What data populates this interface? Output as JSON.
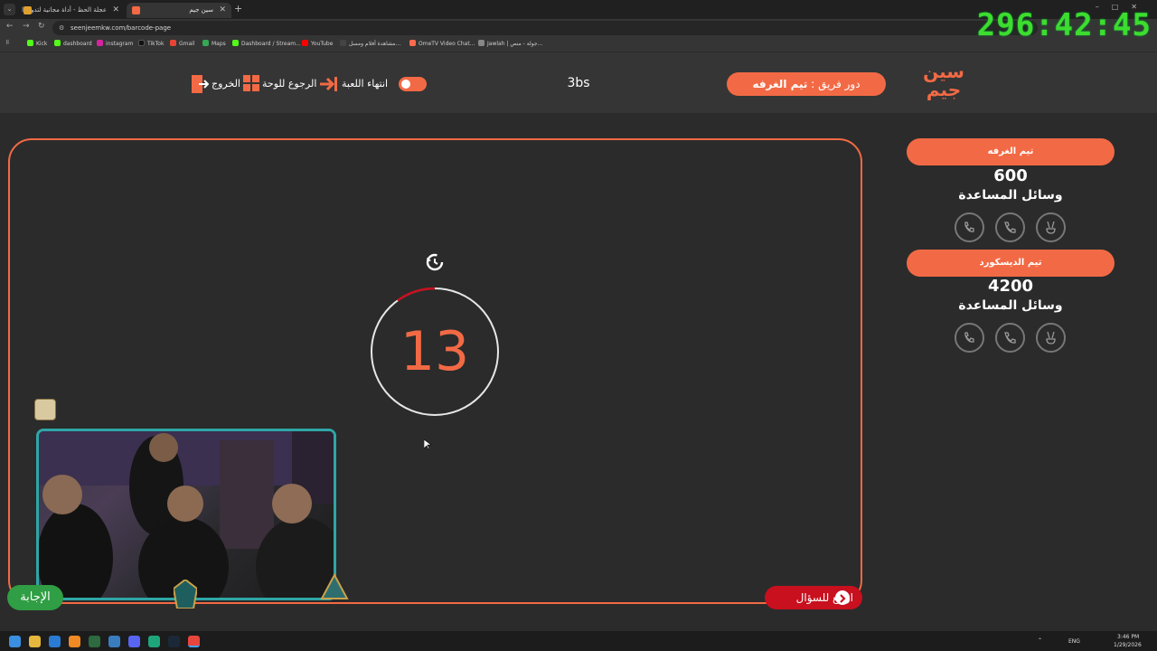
{
  "browser": {
    "tabs": [
      {
        "title": "عجلة الحظ - أداة مجانية لتدوير ا"
      },
      {
        "title": "سين جيم"
      }
    ],
    "url": "seenjeemkw.com/barcode-page",
    "bookmarks": [
      "Kick",
      "dashboard",
      "instagram",
      "TikTok",
      "Gmail",
      "Maps",
      "Dashboard / Stream...",
      "YouTube",
      "مشاهدة أفلام ومسل...",
      "OmeTV Video Chat...",
      "Jawlah | جولة - منص..."
    ]
  },
  "overlay": {
    "stream_timer": "296:42:45"
  },
  "header": {
    "logo_text": "سين جيم",
    "turn_prefix": "دور فريق :",
    "turn_team": "تيم الغرفه",
    "game_name": "3bs",
    "end_game": "انتهاء اللعبة",
    "back_to_board": "الرجوع للوحة",
    "exit": "الخروج"
  },
  "board": {
    "timer_value": "13",
    "timer_fraction_remaining": 0.9,
    "answer_button": "الإجابة",
    "back_to_question": "ارجع للسؤال"
  },
  "teams": [
    {
      "name": "تيم الغرفه",
      "score": "600",
      "helpers_label": "وسائل المساعدة"
    },
    {
      "name": "تيم الديسكورد",
      "score": "4200",
      "helpers_label": "وسائل المساعدة"
    }
  ],
  "taskbar": {
    "lang": "ENG",
    "time": "3:46 PM",
    "date": "1/29/2026"
  },
  "colors": {
    "accent": "#f26a45",
    "danger": "#c8101e",
    "success": "#2f9e44",
    "background": "#2b2b2b"
  }
}
